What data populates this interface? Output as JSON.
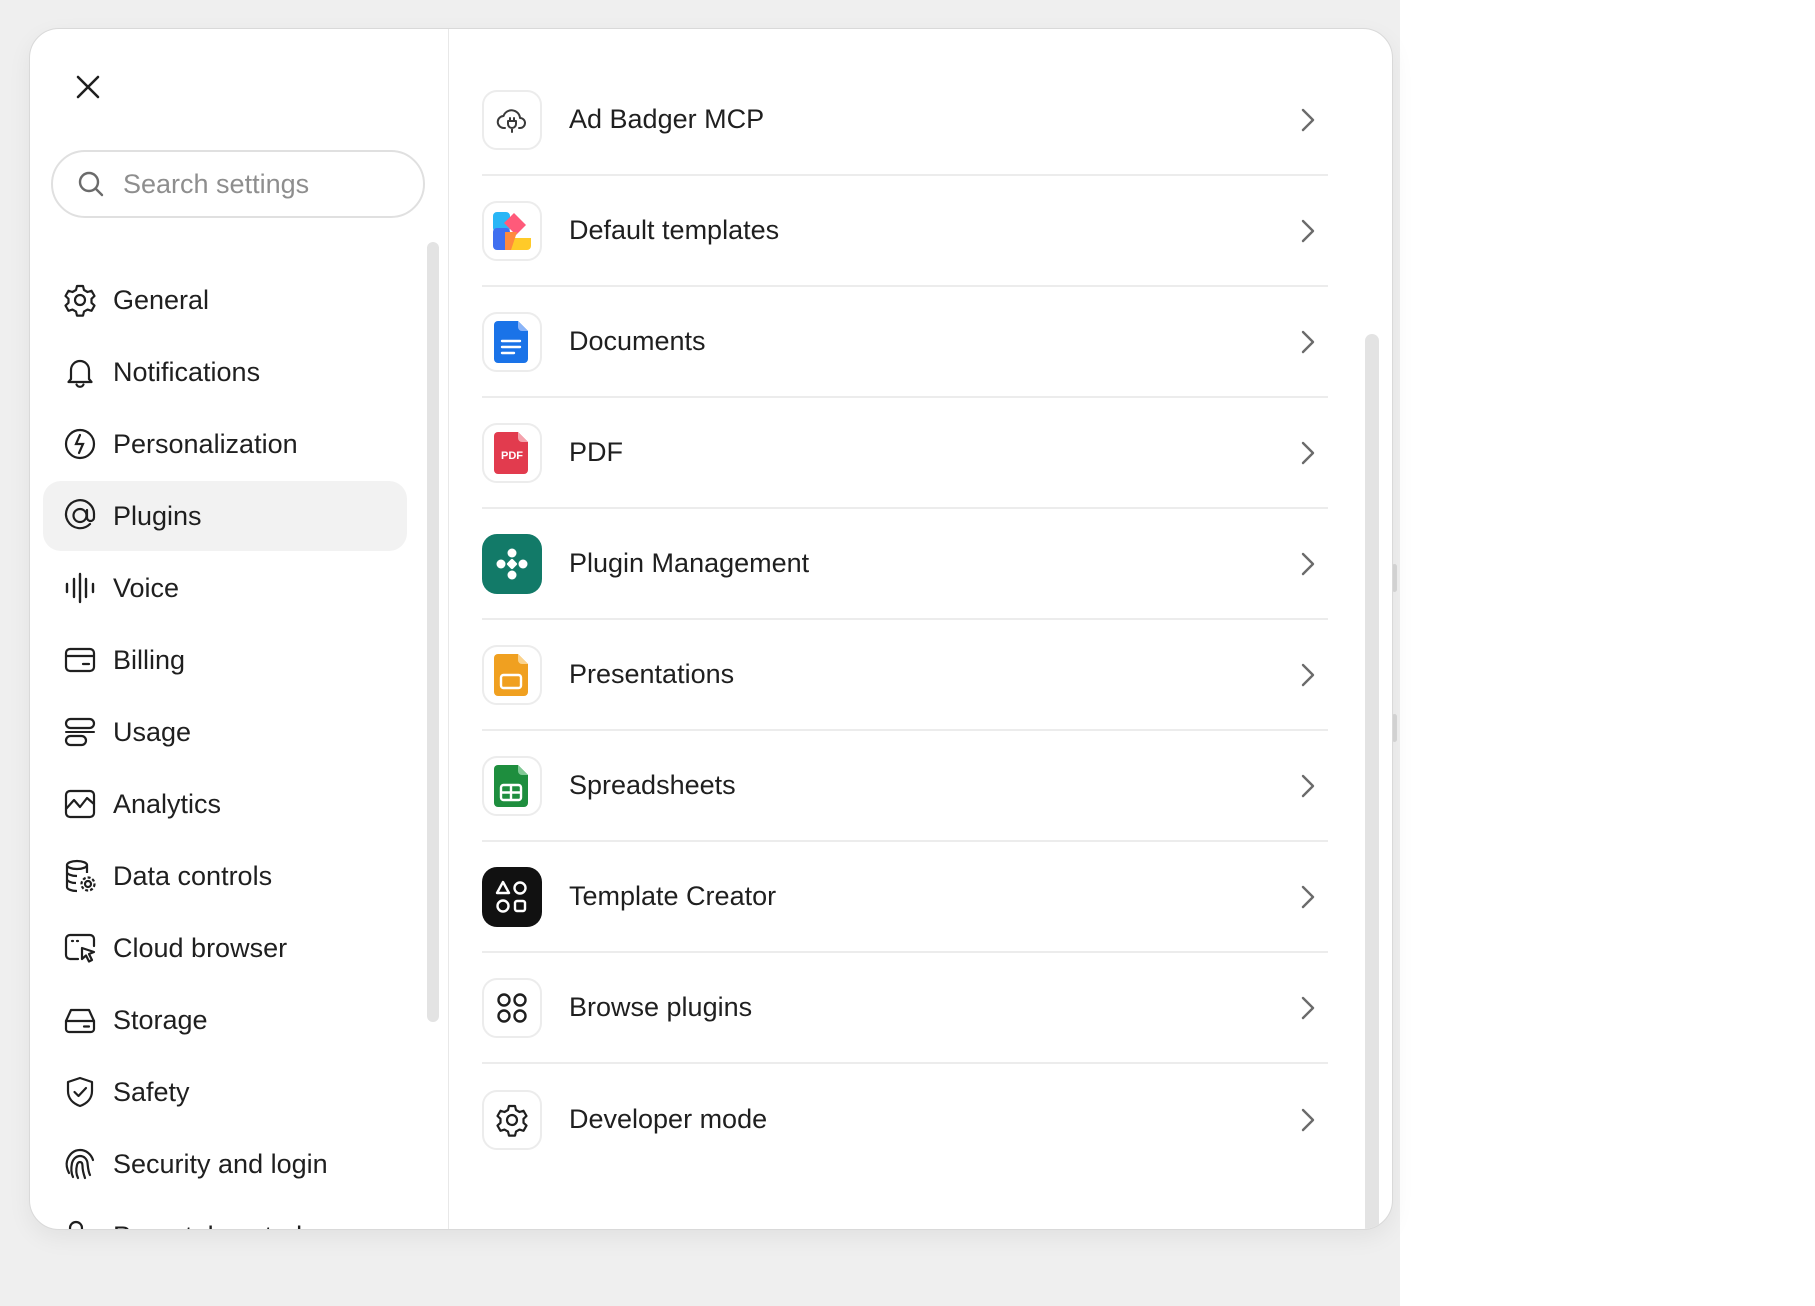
{
  "sidebar": {
    "search_placeholder": "Search settings",
    "active_item": "Plugins",
    "items": [
      {
        "label": "General",
        "icon": "gear-icon"
      },
      {
        "label": "Notifications",
        "icon": "bell-icon"
      },
      {
        "label": "Personalization",
        "icon": "personalization-icon"
      },
      {
        "label": "Plugins",
        "icon": "plugin-at-icon"
      },
      {
        "label": "Voice",
        "icon": "voice-waveform-icon"
      },
      {
        "label": "Billing",
        "icon": "credit-card-icon"
      },
      {
        "label": "Usage",
        "icon": "usage-bars-icon"
      },
      {
        "label": "Analytics",
        "icon": "analytics-chart-icon"
      },
      {
        "label": "Data controls",
        "icon": "database-gear-icon"
      },
      {
        "label": "Cloud browser",
        "icon": "cloud-browser-icon"
      },
      {
        "label": "Storage",
        "icon": "hard-drive-icon"
      },
      {
        "label": "Safety",
        "icon": "shield-check-icon"
      },
      {
        "label": "Security and login",
        "icon": "fingerprint-icon"
      },
      {
        "label": "Parental controls",
        "icon": "user-lock-icon"
      }
    ]
  },
  "plugins": [
    {
      "label": "Ad Badger MCP",
      "icon": "cloud-plug-icon"
    },
    {
      "label": "Default templates",
      "icon": "colorful-templates-icon"
    },
    {
      "label": "Documents",
      "icon": "document-icon"
    },
    {
      "label": "PDF",
      "icon": "pdf-icon",
      "icon_text": "PDF"
    },
    {
      "label": "Plugin Management",
      "icon": "plugin-management-icon"
    },
    {
      "label": "Presentations",
      "icon": "presentation-icon"
    },
    {
      "label": "Spreadsheets",
      "icon": "spreadsheet-icon"
    },
    {
      "label": "Template Creator",
      "icon": "template-creator-icon"
    },
    {
      "label": "Browse plugins",
      "icon": "grid-circles-icon"
    },
    {
      "label": "Developer mode",
      "icon": "gear-icon"
    }
  ],
  "colors": {
    "active_bg": "#f2f2f2",
    "documents_blue": "#1a73e8",
    "pdf_red": "#e23b4e",
    "plugin_mgmt_teal": "#127a68",
    "presentations_orange": "#f0a020",
    "spreadsheets_green": "#1e8e3e"
  }
}
